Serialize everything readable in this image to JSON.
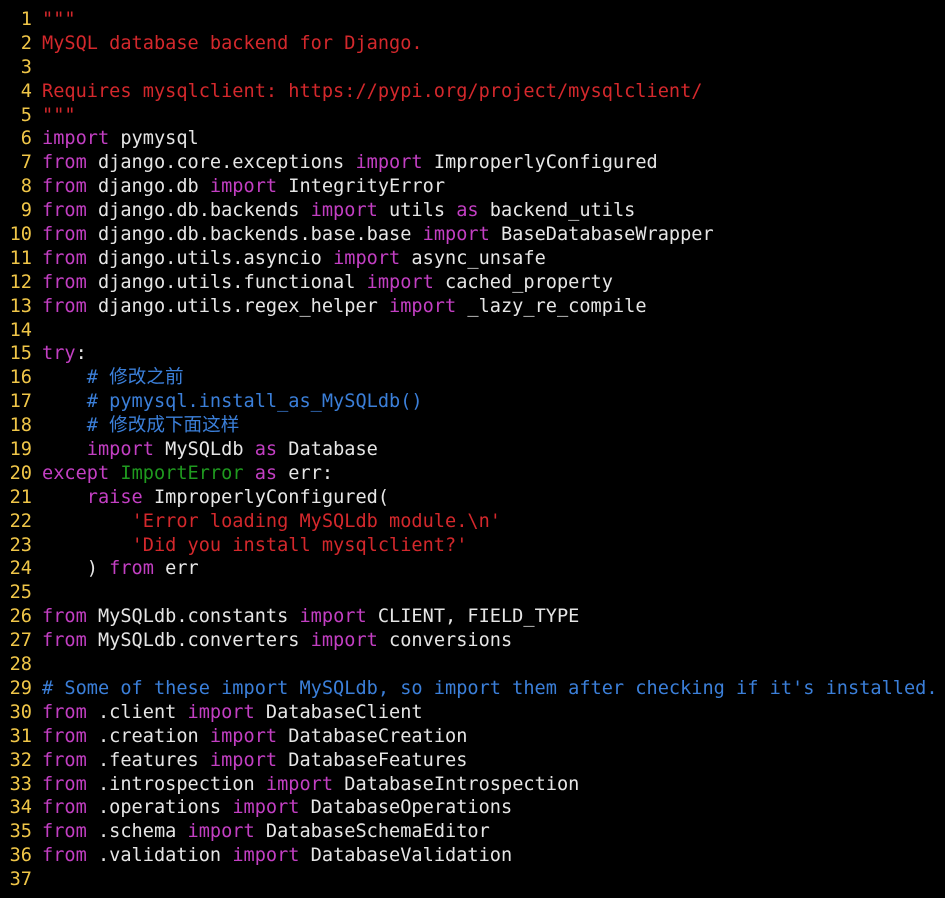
{
  "editor": {
    "line_number_color": "#f0c648",
    "colors": {
      "keyword": "#c33fc3",
      "string": "#d4282c",
      "comment": "#3b7fd9",
      "exception": "#1f9a1f",
      "plain": "#e6e6e6",
      "background": "#000000"
    },
    "lines": [
      {
        "n": "1",
        "tokens": [
          {
            "t": "str",
            "v": "\"\"\""
          }
        ]
      },
      {
        "n": "2",
        "tokens": [
          {
            "t": "str",
            "v": "MySQL database backend for Django."
          }
        ]
      },
      {
        "n": "3",
        "tokens": []
      },
      {
        "n": "4",
        "tokens": [
          {
            "t": "str",
            "v": "Requires mysqlclient: https://pypi.org/project/mysqlclient/"
          }
        ]
      },
      {
        "n": "5",
        "tokens": [
          {
            "t": "str",
            "v": "\"\"\""
          }
        ]
      },
      {
        "n": "6",
        "tokens": [
          {
            "t": "kw",
            "v": "import"
          },
          {
            "t": "plain",
            "v": " pymysql"
          }
        ]
      },
      {
        "n": "7",
        "tokens": [
          {
            "t": "kw",
            "v": "from"
          },
          {
            "t": "plain",
            "v": " django.core.exceptions "
          },
          {
            "t": "kw",
            "v": "import"
          },
          {
            "t": "plain",
            "v": " ImproperlyConfigured"
          }
        ]
      },
      {
        "n": "8",
        "tokens": [
          {
            "t": "kw",
            "v": "from"
          },
          {
            "t": "plain",
            "v": " django.db "
          },
          {
            "t": "kw",
            "v": "import"
          },
          {
            "t": "plain",
            "v": " IntegrityError"
          }
        ]
      },
      {
        "n": "9",
        "tokens": [
          {
            "t": "kw",
            "v": "from"
          },
          {
            "t": "plain",
            "v": " django.db.backends "
          },
          {
            "t": "kw",
            "v": "import"
          },
          {
            "t": "plain",
            "v": " utils "
          },
          {
            "t": "kw",
            "v": "as"
          },
          {
            "t": "plain",
            "v": " backend_utils"
          }
        ]
      },
      {
        "n": "10",
        "tokens": [
          {
            "t": "kw",
            "v": "from"
          },
          {
            "t": "plain",
            "v": " django.db.backends.base.base "
          },
          {
            "t": "kw",
            "v": "import"
          },
          {
            "t": "plain",
            "v": " BaseDatabaseWrapper"
          }
        ]
      },
      {
        "n": "11",
        "tokens": [
          {
            "t": "kw",
            "v": "from"
          },
          {
            "t": "plain",
            "v": " django.utils.asyncio "
          },
          {
            "t": "kw",
            "v": "import"
          },
          {
            "t": "plain",
            "v": " async_unsafe"
          }
        ]
      },
      {
        "n": "12",
        "tokens": [
          {
            "t": "kw",
            "v": "from"
          },
          {
            "t": "plain",
            "v": " django.utils.functional "
          },
          {
            "t": "kw",
            "v": "import"
          },
          {
            "t": "plain",
            "v": " cached_property"
          }
        ]
      },
      {
        "n": "13",
        "tokens": [
          {
            "t": "kw",
            "v": "from"
          },
          {
            "t": "plain",
            "v": " django.utils.regex_helper "
          },
          {
            "t": "kw",
            "v": "import"
          },
          {
            "t": "plain",
            "v": " _lazy_re_compile"
          }
        ]
      },
      {
        "n": "14",
        "tokens": []
      },
      {
        "n": "15",
        "tokens": [
          {
            "t": "kw",
            "v": "try"
          },
          {
            "t": "plain",
            "v": ":"
          }
        ]
      },
      {
        "n": "16",
        "tokens": [
          {
            "t": "plain",
            "v": "    "
          },
          {
            "t": "cmt",
            "v": "# 修改之前"
          }
        ]
      },
      {
        "n": "17",
        "tokens": [
          {
            "t": "plain",
            "v": "    "
          },
          {
            "t": "cmt",
            "v": "# pymysql.install_as_MySQLdb()"
          }
        ]
      },
      {
        "n": "18",
        "tokens": [
          {
            "t": "plain",
            "v": "    "
          },
          {
            "t": "cmt",
            "v": "# 修改成下面这样"
          }
        ]
      },
      {
        "n": "19",
        "tokens": [
          {
            "t": "plain",
            "v": "    "
          },
          {
            "t": "kw",
            "v": "import"
          },
          {
            "t": "plain",
            "v": " MySQLdb "
          },
          {
            "t": "kw",
            "v": "as"
          },
          {
            "t": "plain",
            "v": " Database"
          }
        ]
      },
      {
        "n": "20",
        "tokens": [
          {
            "t": "kw",
            "v": "except"
          },
          {
            "t": "plain",
            "v": " "
          },
          {
            "t": "exc",
            "v": "ImportError"
          },
          {
            "t": "plain",
            "v": " "
          },
          {
            "t": "kw",
            "v": "as"
          },
          {
            "t": "plain",
            "v": " err:"
          }
        ]
      },
      {
        "n": "21",
        "tokens": [
          {
            "t": "plain",
            "v": "    "
          },
          {
            "t": "kw",
            "v": "raise"
          },
          {
            "t": "plain",
            "v": " ImproperlyConfigured("
          }
        ]
      },
      {
        "n": "22",
        "tokens": [
          {
            "t": "plain",
            "v": "        "
          },
          {
            "t": "str",
            "v": "'Error loading MySQLdb module.\\n'"
          }
        ]
      },
      {
        "n": "23",
        "tokens": [
          {
            "t": "plain",
            "v": "        "
          },
          {
            "t": "str",
            "v": "'Did you install mysqlclient?'"
          }
        ]
      },
      {
        "n": "24",
        "tokens": [
          {
            "t": "plain",
            "v": "    ) "
          },
          {
            "t": "kw",
            "v": "from"
          },
          {
            "t": "plain",
            "v": " err"
          }
        ]
      },
      {
        "n": "25",
        "tokens": []
      },
      {
        "n": "26",
        "tokens": [
          {
            "t": "kw",
            "v": "from"
          },
          {
            "t": "plain",
            "v": " MySQLdb.constants "
          },
          {
            "t": "kw",
            "v": "import"
          },
          {
            "t": "plain",
            "v": " CLIENT, FIELD_TYPE"
          }
        ]
      },
      {
        "n": "27",
        "tokens": [
          {
            "t": "kw",
            "v": "from"
          },
          {
            "t": "plain",
            "v": " MySQLdb.converters "
          },
          {
            "t": "kw",
            "v": "import"
          },
          {
            "t": "plain",
            "v": " conversions"
          }
        ]
      },
      {
        "n": "28",
        "tokens": []
      },
      {
        "n": "29",
        "tokens": [
          {
            "t": "cmt",
            "v": "# Some of these import MySQLdb, so import them after checking if it's installed."
          }
        ]
      },
      {
        "n": "30",
        "tokens": [
          {
            "t": "kw",
            "v": "from"
          },
          {
            "t": "plain",
            "v": " .client "
          },
          {
            "t": "kw",
            "v": "import"
          },
          {
            "t": "plain",
            "v": " DatabaseClient"
          }
        ]
      },
      {
        "n": "31",
        "tokens": [
          {
            "t": "kw",
            "v": "from"
          },
          {
            "t": "plain",
            "v": " .creation "
          },
          {
            "t": "kw",
            "v": "import"
          },
          {
            "t": "plain",
            "v": " DatabaseCreation"
          }
        ]
      },
      {
        "n": "32",
        "tokens": [
          {
            "t": "kw",
            "v": "from"
          },
          {
            "t": "plain",
            "v": " .features "
          },
          {
            "t": "kw",
            "v": "import"
          },
          {
            "t": "plain",
            "v": " DatabaseFeatures"
          }
        ]
      },
      {
        "n": "33",
        "tokens": [
          {
            "t": "kw",
            "v": "from"
          },
          {
            "t": "plain",
            "v": " .introspection "
          },
          {
            "t": "kw",
            "v": "import"
          },
          {
            "t": "plain",
            "v": " DatabaseIntrospection"
          }
        ]
      },
      {
        "n": "34",
        "tokens": [
          {
            "t": "kw",
            "v": "from"
          },
          {
            "t": "plain",
            "v": " .operations "
          },
          {
            "t": "kw",
            "v": "import"
          },
          {
            "t": "plain",
            "v": " DatabaseOperations"
          }
        ]
      },
      {
        "n": "35",
        "tokens": [
          {
            "t": "kw",
            "v": "from"
          },
          {
            "t": "plain",
            "v": " .schema "
          },
          {
            "t": "kw",
            "v": "import"
          },
          {
            "t": "plain",
            "v": " DatabaseSchemaEditor"
          }
        ]
      },
      {
        "n": "36",
        "tokens": [
          {
            "t": "kw",
            "v": "from"
          },
          {
            "t": "plain",
            "v": " .validation "
          },
          {
            "t": "kw",
            "v": "import"
          },
          {
            "t": "plain",
            "v": " DatabaseValidation"
          }
        ]
      },
      {
        "n": "37",
        "tokens": []
      }
    ]
  }
}
